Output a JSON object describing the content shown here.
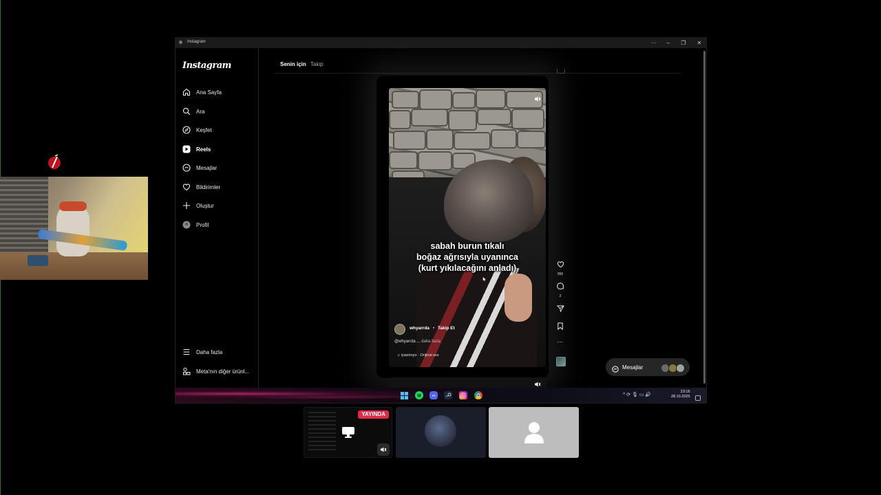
{
  "window": {
    "title": "Instagram",
    "controls": [
      "···",
      "–",
      "❐",
      "✕"
    ]
  },
  "sidebar": {
    "logo": "Instagram",
    "items": [
      {
        "label": "Ana Sayfa",
        "icon": "home-icon"
      },
      {
        "label": "Ara",
        "icon": "search-icon"
      },
      {
        "label": "Keşfet",
        "icon": "compass-icon"
      },
      {
        "label": "Reels",
        "icon": "reels-icon",
        "active": true
      },
      {
        "label": "Mesajlar",
        "icon": "messenger-icon"
      },
      {
        "label": "Bildirimler",
        "icon": "heart-icon"
      },
      {
        "label": "Oluştur",
        "icon": "plus-icon"
      },
      {
        "label": "Profil",
        "icon": "avatar-icon"
      }
    ],
    "bottom": [
      {
        "label": "Daha fazla",
        "icon": "menu-icon"
      },
      {
        "label": "Meta'nın diğer ürünl...",
        "icon": "meta-apps-icon"
      }
    ]
  },
  "tabs": {
    "for_you": "Senin için",
    "following": "Takip"
  },
  "reel": {
    "caption": [
      "sabah burun tıkalı",
      "boğaz ağrısıyla uyanınca",
      "(kurt yıkılacağını anladı)"
    ],
    "username": "whyarrda",
    "separator": "•",
    "follow": "Takip Et",
    "description": "@whyarrda ...",
    "more": "daha fazla",
    "audio": "♫ iyasinnyo · Orijinal ses",
    "likes": "956",
    "comments": "2"
  },
  "messages_pill": {
    "label": "Mesajlar"
  },
  "taskbar": {
    "time": "23:16",
    "date": "28.10.2025",
    "tray": "^ ⟳ 🎙 ▭ 🔊"
  },
  "tiles": {
    "live_badge": "YAYINDA"
  },
  "colors": {
    "accent_live": "#e02a49",
    "background": "#000000"
  }
}
